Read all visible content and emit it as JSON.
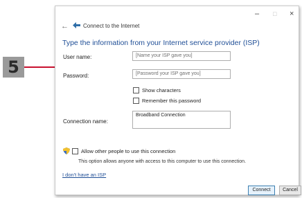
{
  "step": {
    "number": "5"
  },
  "window": {
    "controls": {
      "minimize": "–",
      "maximize": "□",
      "close": "×"
    },
    "nav": {
      "back": "←",
      "title": "Connect to the Internet"
    }
  },
  "form": {
    "heading": "Type the information from your Internet service provider (ISP)",
    "username": {
      "label": "User name:",
      "placeholder": "[Name your ISP gave you]"
    },
    "password": {
      "label": "Password:",
      "placeholder": "[Password your ISP gave you]"
    },
    "show_characters": {
      "label": "Show characters",
      "checked": false
    },
    "remember_password": {
      "label": "Remember this password",
      "checked": false
    },
    "connection_name": {
      "label": "Connection name:",
      "value": "Broadband Connection"
    },
    "allow_others": {
      "label": "Allow other people to use this connection",
      "checked": false
    },
    "allow_others_desc": "This option allows anyone with access to this computer to use this connection.",
    "no_isp_link": "I don't have an ISP"
  },
  "buttons": {
    "connect": "Connect",
    "cancel": "Cancel"
  },
  "colors": {
    "callout": "#c8102e",
    "heading": "#1f4e96",
    "badge": "#9a9a9a"
  },
  "icons": {
    "nav": "network-icon",
    "shield": "uac-shield-icon"
  }
}
